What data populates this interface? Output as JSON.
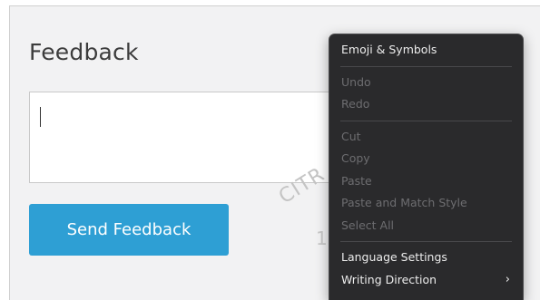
{
  "page": {
    "title": "Feedback",
    "send_button_label": "Send Feedback",
    "watermark_line1": "CITR",
    "watermark_line2": "1"
  },
  "context_menu": {
    "emoji_symbols": "Emoji & Symbols",
    "undo": "Undo",
    "redo": "Redo",
    "cut": "Cut",
    "copy": "Copy",
    "paste": "Paste",
    "paste_match_style": "Paste and Match Style",
    "select_all": "Select All",
    "language_settings": "Language Settings",
    "writing_direction": "Writing Direction",
    "submenu_arrow": "›"
  },
  "colors": {
    "accent": "#2e9fd4",
    "menu_bg": "#2a2a2c",
    "page_bg": "#f2f2f3"
  }
}
